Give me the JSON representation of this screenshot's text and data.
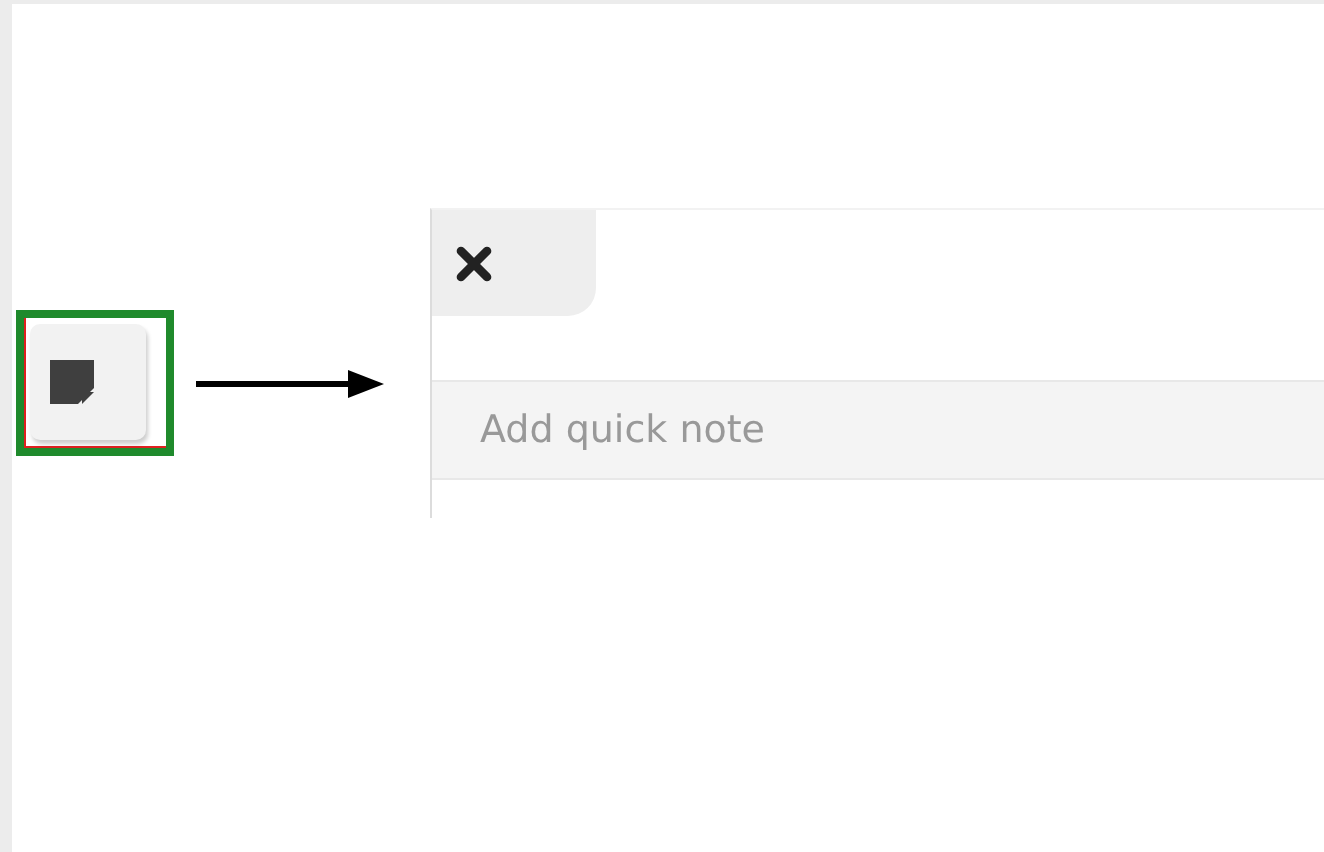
{
  "note_panel": {
    "input": {
      "placeholder": "Add quick note"
    }
  }
}
